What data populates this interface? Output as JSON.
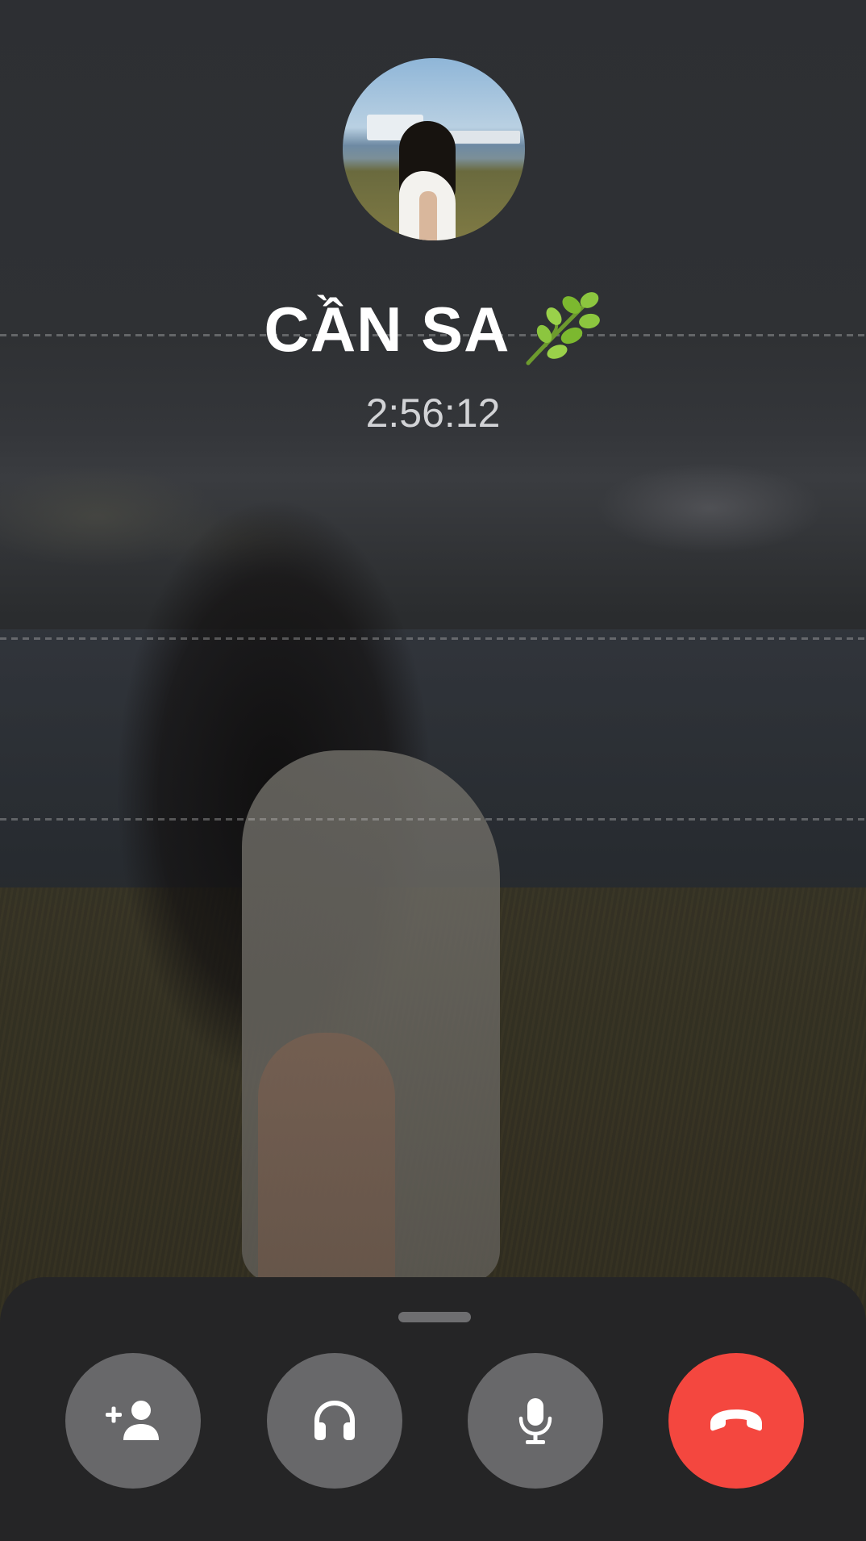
{
  "call": {
    "contact_name": "CẦN SA",
    "contact_emoji": "🌿",
    "duration": "2:56:12"
  },
  "controls": {
    "add_participant_icon": "add-person-icon",
    "audio_output_icon": "headphones-icon",
    "microphone_icon": "microphone-icon",
    "end_call_icon": "hang-up-phone-icon",
    "end_call_color": "#f4473f",
    "button_color": "#68686a"
  }
}
